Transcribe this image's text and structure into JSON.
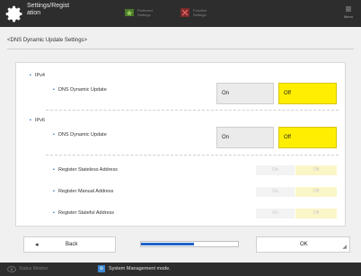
{
  "titlebar": {
    "title": "Settings/Regist\nation",
    "tabs": [
      {
        "label": "Preferred\nSettings",
        "icon": "star-icon"
      },
      {
        "label": "Function\nSettings",
        "icon": "tools-icon"
      }
    ],
    "menu_label": "Menu",
    "icon": "gear-icon"
  },
  "heading": "<DNS Dynamic Update Settings>",
  "ipv4": {
    "section_label": "IPv4",
    "dns_label": "DNS Dynamic Update",
    "on_label": "On",
    "off_label": "Off",
    "selected": "Off"
  },
  "ipv6": {
    "section_label": "IPv6",
    "dns_label": "DNS Dynamic Update",
    "on_label": "On",
    "off_label": "Off",
    "selected": "Off",
    "rows": [
      {
        "label": "Register Stateless Address",
        "on": "On",
        "off": "Off"
      },
      {
        "label": "Register Manual Address",
        "on": "On",
        "off": "Off"
      },
      {
        "label": "Register Stateful Address",
        "on": "On",
        "off": "Off"
      }
    ]
  },
  "footer": {
    "back_label": "Back",
    "ok_label": "OK",
    "progress": 0.55
  },
  "statusbar": {
    "monitor_label": "Status Monitor",
    "mode_label": "System Management mode."
  },
  "colors": {
    "selected_yellow": "#ffee00",
    "accent_blue": "#1e63c8",
    "dark_bar": "#2d2d2d"
  }
}
